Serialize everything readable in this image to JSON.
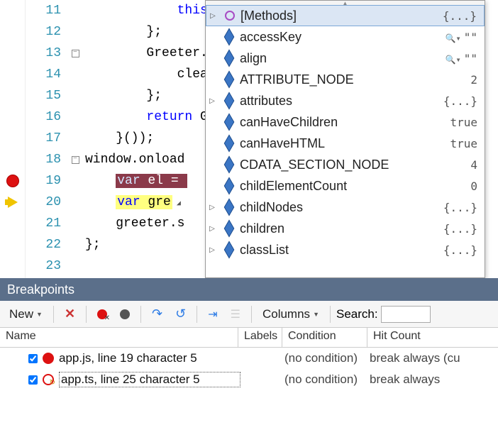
{
  "editor": {
    "lines": [
      {
        "num": 11,
        "text": "            this."
      },
      {
        "num": 12,
        "text": "        };"
      },
      {
        "num": 13,
        "text": "        Greeter.p",
        "fold": "-"
      },
      {
        "num": 14,
        "text": "            clear"
      },
      {
        "num": 15,
        "text": "        };"
      },
      {
        "num": 16,
        "text": "        return Gr",
        "kw_start": 8,
        "kw_end": 14
      },
      {
        "num": 17,
        "text": "    }());"
      },
      {
        "num": 18,
        "text": "window.onload",
        "fold": "-"
      },
      {
        "num": 19,
        "text": "    var el = ",
        "highlight": "red",
        "kw_text": "var",
        "kw_at": 4,
        "gutter": "breakpoint"
      },
      {
        "num": 20,
        "text": "    var gre",
        "highlight": "yellow",
        "kw_text": "var",
        "kw_at": 4,
        "gutter": "current"
      },
      {
        "num": 21,
        "text": "    greeter.s"
      },
      {
        "num": 22,
        "text": "};"
      },
      {
        "num": 23,
        "text": ""
      }
    ]
  },
  "intellisense": {
    "items": [
      {
        "exp": "▷",
        "icon": "methods",
        "name": "[Methods]",
        "value": "{...}",
        "selected": true
      },
      {
        "exp": "",
        "icon": "prop",
        "name": "accessKey",
        "value": "\"\"",
        "mag": true
      },
      {
        "exp": "",
        "icon": "prop",
        "name": "align",
        "value": "\"\"",
        "mag": true
      },
      {
        "exp": "",
        "icon": "prop",
        "name": "ATTRIBUTE_NODE",
        "value": "2"
      },
      {
        "exp": "▷",
        "icon": "prop",
        "name": "attributes",
        "value": "{...}"
      },
      {
        "exp": "",
        "icon": "prop",
        "name": "canHaveChildren",
        "value": "true"
      },
      {
        "exp": "",
        "icon": "prop",
        "name": "canHaveHTML",
        "value": "true"
      },
      {
        "exp": "",
        "icon": "prop",
        "name": "CDATA_SECTION_NODE",
        "value": "4"
      },
      {
        "exp": "",
        "icon": "prop",
        "name": "childElementCount",
        "value": "0"
      },
      {
        "exp": "▷",
        "icon": "prop",
        "name": "childNodes",
        "value": "{...}"
      },
      {
        "exp": "▷",
        "icon": "prop",
        "name": "children",
        "value": "{...}"
      },
      {
        "exp": "▷",
        "icon": "prop",
        "name": "classList",
        "value": "{...}"
      }
    ],
    "left_exp": "◢"
  },
  "breakpoints": {
    "title": "Breakpoints",
    "toolbar": {
      "new": "New",
      "columns": "Columns",
      "search_label": "Search:",
      "search_value": ""
    },
    "headers": {
      "name": "Name",
      "labels": "Labels",
      "condition": "Condition",
      "hit": "Hit Count"
    },
    "items": [
      {
        "checked": true,
        "icon": "red",
        "text": "app.js, line 19 character 5",
        "labels": "",
        "condition": "(no condition)",
        "hit": "break always (cu",
        "selected": false
      },
      {
        "checked": true,
        "icon": "ts",
        "text": "app.ts, line 25 character 5",
        "labels": "",
        "condition": "(no condition)",
        "hit": "break always",
        "selected": true
      }
    ]
  }
}
